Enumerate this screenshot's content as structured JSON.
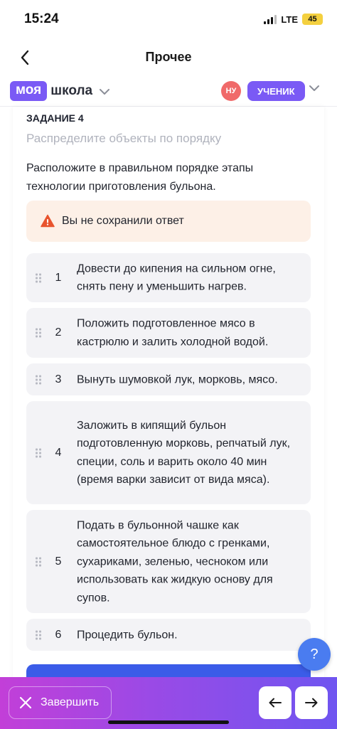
{
  "status_bar": {
    "time": "15:24",
    "network": "LTE",
    "battery": "45"
  },
  "nav": {
    "title": "Прочее"
  },
  "brand": {
    "logo_part1": "моя",
    "logo_part2": "школа",
    "avatar_initials": "НУ",
    "role": "УЧЕНИК"
  },
  "task": {
    "label": "ЗАДАНИЕ 4",
    "hint": "Распределите объекты по порядку",
    "text": "Расположите в правильном порядке этапы технологии приготовления бульона."
  },
  "warning": {
    "text": "Вы не сохранили ответ"
  },
  "items": [
    {
      "num": "1",
      "text": "Довести до кипения на сильном огне, снять пену и уменьшить нагрев."
    },
    {
      "num": "2",
      "text": "Положить подготовленное мясо в кастрюлю и залить холодной водой."
    },
    {
      "num": "3",
      "text": "Вынуть шумовкой лук, морковь, мясо."
    },
    {
      "num": "4",
      "text": "Заложить в кипящий бульон подготовленную морковь, репчатый лук, специи, соль и варить около 40 мин (время варки зависит от вида мяса)."
    },
    {
      "num": "5",
      "text": "Подать в бульонной чашке как самостоятельное блюдо с гренками, сухариками, зеленью, чесноком или использовать как жидкую основу для супов."
    },
    {
      "num": "6",
      "text": "Процедить бульон."
    }
  ],
  "help": {
    "label": "?"
  },
  "bottom": {
    "finish_label": "Завершить"
  },
  "colors": {
    "accent": "#7a5af5",
    "warning_bg": "#fdf0e7",
    "warning_icon": "#e8542e",
    "help": "#4a7cf0"
  }
}
